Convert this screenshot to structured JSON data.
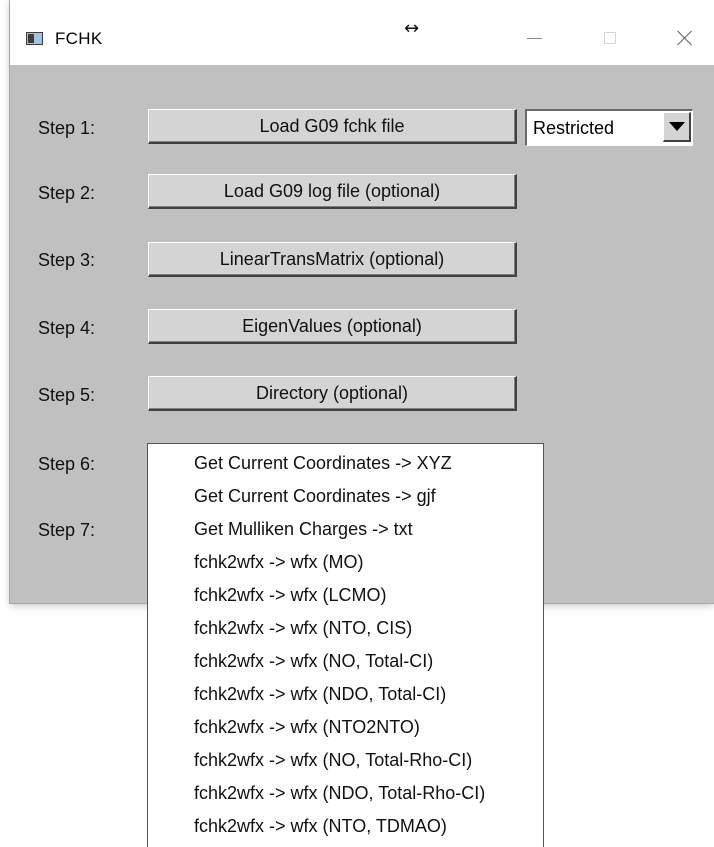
{
  "window": {
    "title": "FCHK",
    "resize_glyph": "↔",
    "controls": [
      "minimize-icon",
      "maximize-icon",
      "close-icon"
    ]
  },
  "steps": [
    {
      "label": "Step 1:",
      "button": "Load G09 fchk file"
    },
    {
      "label": "Step 2:",
      "button": "Load G09 log file (optional)"
    },
    {
      "label": "Step 3:",
      "button": "LinearTransMatrix (optional)"
    },
    {
      "label": "Step 4:",
      "button": "EigenValues (optional)"
    },
    {
      "label": "Step 5:",
      "button": "Directory (optional)"
    },
    {
      "label": "Step 6:"
    },
    {
      "label": "Step 7:"
    }
  ],
  "spin_select": {
    "value": "Restricted"
  },
  "operations": [
    "Get Current Coordinates -> XYZ",
    "Get Current Coordinates -> gjf",
    "Get Mulliken Charges -> txt",
    "fchk2wfx -> wfx (MO)",
    "fchk2wfx -> wfx (LCMO)",
    "fchk2wfx -> wfx (NTO, CIS)",
    "fchk2wfx -> wfx (NO, Total-CI)",
    "fchk2wfx -> wfx (NDO, Total-CI)",
    "fchk2wfx -> wfx (NTO2NTO)",
    "fchk2wfx -> wfx (NO, Total-Rho-CI)",
    "fchk2wfx -> wfx (NDO, Total-Rho-CI)",
    "fchk2wfx -> wfx (NTO, TDMAO)"
  ]
}
